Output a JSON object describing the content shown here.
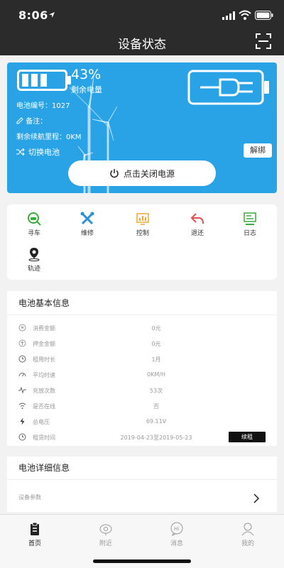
{
  "status_bar": {
    "time": "8:06"
  },
  "header": {
    "title": "设备状态"
  },
  "battery_card": {
    "level_percent": "43%",
    "remain_label": "剩余电量",
    "battery_no": "电池编号：1027",
    "note": "备注：",
    "range": "剩余续航里程：0KM",
    "switch_label": "切换电池",
    "unbind_label": "解绑",
    "power_button_label": "点击关闭电源"
  },
  "menu": {
    "items": [
      {
        "label": "寻车",
        "icon": "find-car-icon",
        "color": "#3caa3c"
      },
      {
        "label": "维修",
        "icon": "repair-tools-icon",
        "color": "#2a8fd8"
      },
      {
        "label": "控制",
        "icon": "control-chart-icon",
        "color": "#f0a830"
      },
      {
        "label": "退还",
        "icon": "return-arrow-icon",
        "color": "#e05050"
      },
      {
        "label": "日志",
        "icon": "log-monitor-icon",
        "color": "#3caa3c"
      },
      {
        "label": "轨迹",
        "icon": "track-pin-icon",
        "color": "#222222"
      }
    ]
  },
  "battery_info": {
    "title": "电池基本信息",
    "rows": [
      {
        "label": "消费金额",
        "value": "0元",
        "icon": "money-icon"
      },
      {
        "label": "押金金额",
        "value": "0元",
        "icon": "deposit-icon"
      },
      {
        "label": "租用时长",
        "value": "1月",
        "icon": "clock-icon"
      },
      {
        "label": "平均时速",
        "value": "0KM/H",
        "icon": "speed-icon"
      },
      {
        "label": "充放次数",
        "value": "53次",
        "icon": "pulse-icon"
      },
      {
        "label": "是否在线",
        "value": "否",
        "icon": "wifi-icon"
      },
      {
        "label": "总电压",
        "value": "69.11V",
        "icon": "lightning-icon"
      },
      {
        "label": "租赁时间",
        "value": "2019-04-23至2019-05-23",
        "icon": "clock-icon"
      }
    ],
    "renew_label": "续租"
  },
  "battery_detail": {
    "title": "电池详细信息",
    "param_label": "设备参数"
  },
  "tabbar": {
    "tabs": [
      {
        "label": "首页",
        "icon": "home-clipboard-icon",
        "active": true
      },
      {
        "label": "附近",
        "icon": "nearby-location-icon",
        "active": false
      },
      {
        "label": "消息",
        "icon": "message-bubble-icon",
        "active": false
      },
      {
        "label": "我的",
        "icon": "profile-person-icon",
        "active": false
      }
    ]
  },
  "colors": {
    "card_blue": "#29a3e6",
    "topbar": "#2b2b2b",
    "background": "#f2f2f2"
  }
}
